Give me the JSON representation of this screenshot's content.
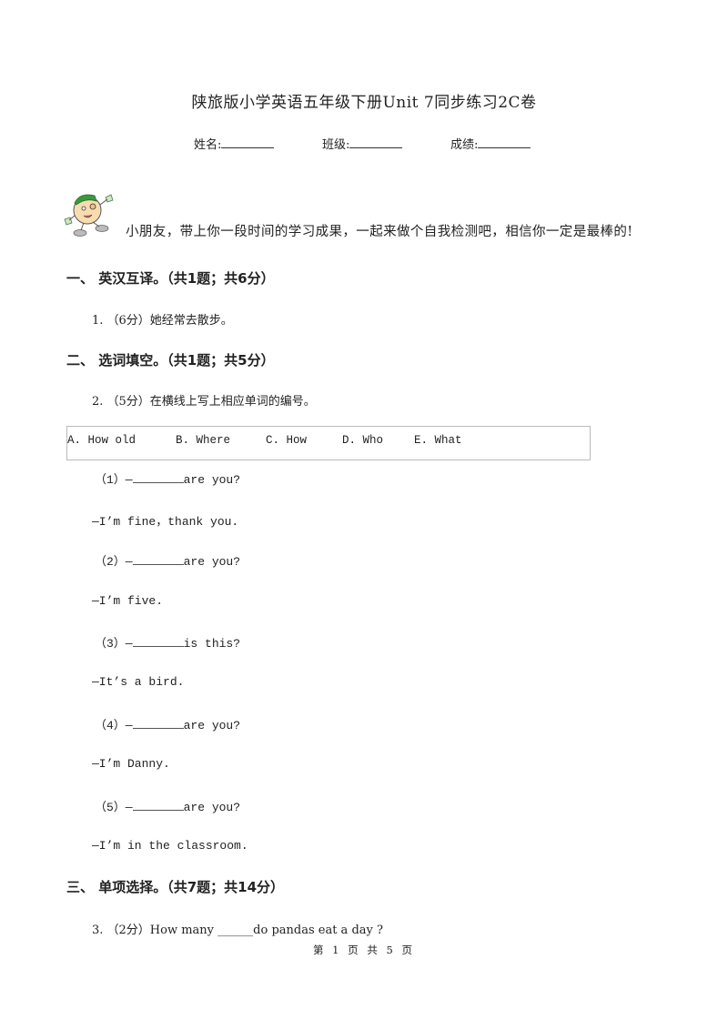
{
  "header": {
    "title": "陕旅版小学英语五年级下册Unit 7同步练习2C卷",
    "fields": [
      {
        "label": "姓名:"
      },
      {
        "label": "班级:"
      },
      {
        "label": "成绩:"
      }
    ]
  },
  "intro": {
    "mascot": "cartoon-boy-icon",
    "text": "小朋友，带上你一段时间的学习成果，一起来做个自我检测吧，相信你一定是最棒的!"
  },
  "sections": [
    {
      "heading": "一、  英汉互译。（共1题；共6分）",
      "questions": [
        {
          "text": "1.  （6分）她经常去散步。"
        }
      ]
    },
    {
      "heading": "二、  选词填空。（共1题；共5分）",
      "questions": [
        {
          "text": "2.  （5分）在横线上写上相应单词的编号。",
          "options": [
            "A. How old",
            "B. Where",
            "C. How",
            "D. Who",
            "E. What"
          ],
          "items": [
            {
              "prefix": "（1）—",
              "suffix": "are you?",
              "answer": "—I’m fine，thank you."
            },
            {
              "prefix": "（2）—",
              "suffix": "are you?",
              "answer": "—I’m five."
            },
            {
              "prefix": "（3）—",
              "suffix": "is this?",
              "answer": "—It’s a bird."
            },
            {
              "prefix": "（4）—",
              "suffix": "are you?",
              "answer": "—I’m Danny."
            },
            {
              "prefix": "（5）—",
              "suffix": "are you?",
              "answer": "—I’m in the classroom."
            }
          ]
        }
      ]
    },
    {
      "heading": "三、  单项选择。（共7题；共14分）",
      "questions": [
        {
          "text": "3.  （2分）How many ______do pandas eat a day ?"
        }
      ]
    }
  ],
  "footer": {
    "page_label": "第 1 页 共 5 页"
  }
}
